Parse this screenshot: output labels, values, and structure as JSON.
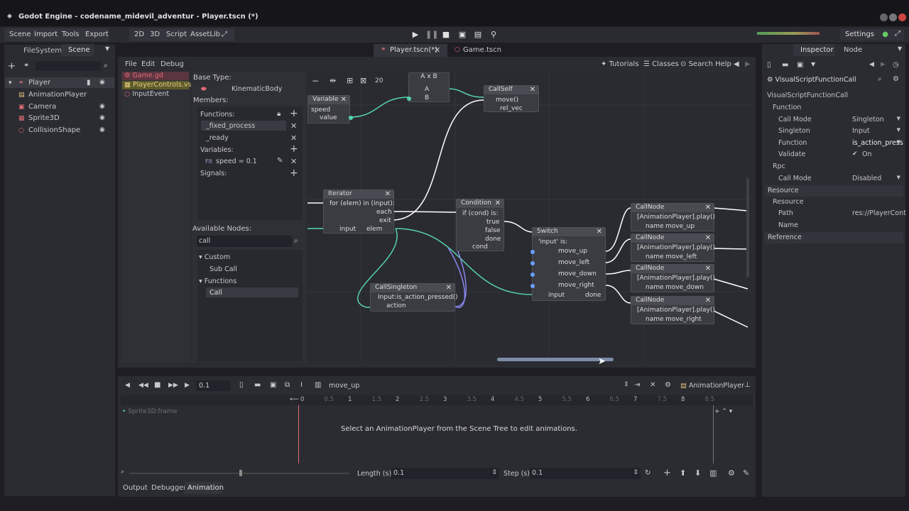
{
  "window": {
    "title": "Godot Engine - codename_midevil_adventur - Player.tscn (*)"
  },
  "menu": {
    "items": [
      "Scene",
      "Import",
      "Tools",
      "Export"
    ],
    "mode_items": [
      "2D",
      "3D",
      "Script",
      "AssetLib"
    ],
    "settings": "Settings"
  },
  "left_panel": {
    "tabs": [
      "FileSystem",
      "Scene"
    ],
    "tree": [
      {
        "label": "Player",
        "icon": "player-icon"
      },
      {
        "label": "AnimationPlayer"
      },
      {
        "label": "Camera"
      },
      {
        "label": "Sprite3D"
      },
      {
        "label": "CollisionShape"
      }
    ]
  },
  "editor_tabs": [
    "Player.tscn(*)",
    "Game.tscn"
  ],
  "script_menu": [
    "File",
    "Edit",
    "Debug"
  ],
  "script_toolbar": {
    "tutorials": "Tutorials",
    "classes": "Classes",
    "search_help": "Search Help"
  },
  "scripts": [
    "Game.gd",
    "PlayerControls.vs",
    "InputEvent"
  ],
  "members": {
    "base_type_label": "Base Type:",
    "base_type": "KinematicBody",
    "members_label": "Members:",
    "functions_label": "Functions:",
    "functions": [
      "_fixed_process",
      "_ready"
    ],
    "variables_label": "Variables:",
    "variables": [
      {
        "prefix": "Flt",
        "text": "speed = 0.1"
      }
    ],
    "signals_label": "Signals:",
    "available_label": "Available Nodes:",
    "search_value": "call",
    "tree": {
      "custom": "Custom",
      "sub_call": "Sub Call",
      "functions": "Functions",
      "call": "Call"
    }
  },
  "graph": {
    "zoom": "20",
    "variable": {
      "title": "Variable",
      "name": "speed",
      "out": "value"
    },
    "axb": {
      "title": "A x B",
      "a": "A",
      "b": "B"
    },
    "callself": {
      "title": "CallSelf",
      "func": "move()",
      "arg": "rel_vec"
    },
    "iterator": {
      "title": "Iterator",
      "desc": "for (elem) in (input):",
      "each": "each",
      "exit": "exit",
      "input": "input",
      "elem": "elem"
    },
    "condition": {
      "title": "Condition",
      "desc": "if (cond) is:",
      "true": "true",
      "false": "false",
      "done": "done",
      "cond": "cond"
    },
    "switch": {
      "title": "Switch",
      "desc": "'input' is:",
      "cases": [
        "move_up",
        "move_left",
        "move_down",
        "move_right"
      ],
      "input": "input",
      "done": "done"
    },
    "callsingleton": {
      "title": "CallSingleton",
      "func": "Input:is_action_pressed()",
      "arg": "action"
    },
    "callnodes": [
      {
        "title": "CallNode",
        "func": "[AnimationPlayer].play()",
        "name_label": "name",
        "name": "move_up"
      },
      {
        "title": "CallNode",
        "func": "[AnimationPlayer].play()",
        "name_label": "name",
        "name": "move_left"
      },
      {
        "title": "CallNode",
        "func": "[AnimationPlayer].play()",
        "name_label": "name",
        "name": "move_down"
      },
      {
        "title": "CallNode",
        "func": "[AnimationPlayer].play()",
        "name_label": "name",
        "name": "move_right"
      }
    ]
  },
  "animation": {
    "time": "0.1",
    "anim_name": "move_up",
    "player_label": "AnimationPlayer",
    "track": "Sprite3D:frame",
    "message": "Select an AnimationPlayer from the Scene Tree to edit animations.",
    "length_label": "Length (s):",
    "length": "0.1",
    "step_label": "Step (s):",
    "step": "0.1",
    "ruler": [
      "0",
      "0.5",
      "1",
      "1.5",
      "2",
      "2.5",
      "3",
      "3.5",
      "4",
      "4.5",
      "5",
      "5.5",
      "6",
      "6.5",
      "7",
      "7.5",
      "8",
      "8.5"
    ]
  },
  "bottom_tabs": [
    "Output",
    "Debugger",
    "Animation"
  ],
  "inspector": {
    "tabs": [
      "Inspector",
      "Node"
    ],
    "object": "VisualScriptFunctionCall",
    "class_label": "VisualScriptFunctionCall",
    "function_section": "Function",
    "rows": [
      {
        "k": "Call Mode",
        "v": "Singleton"
      },
      {
        "k": "Singleton",
        "v": "Input"
      },
      {
        "k": "Function",
        "v": "is_action_press"
      },
      {
        "k": "Validate",
        "v": "On"
      }
    ],
    "rpc_section": "Rpc",
    "rpc_rows": [
      {
        "k": "Call Mode",
        "v": "Disabled"
      }
    ],
    "resource_section": "Resource",
    "resource_sub": "Resource",
    "resource_rows": [
      {
        "k": "Path",
        "v": "res://PlayerCont"
      },
      {
        "k": "Name",
        "v": ""
      }
    ],
    "reference_section": "Reference"
  }
}
